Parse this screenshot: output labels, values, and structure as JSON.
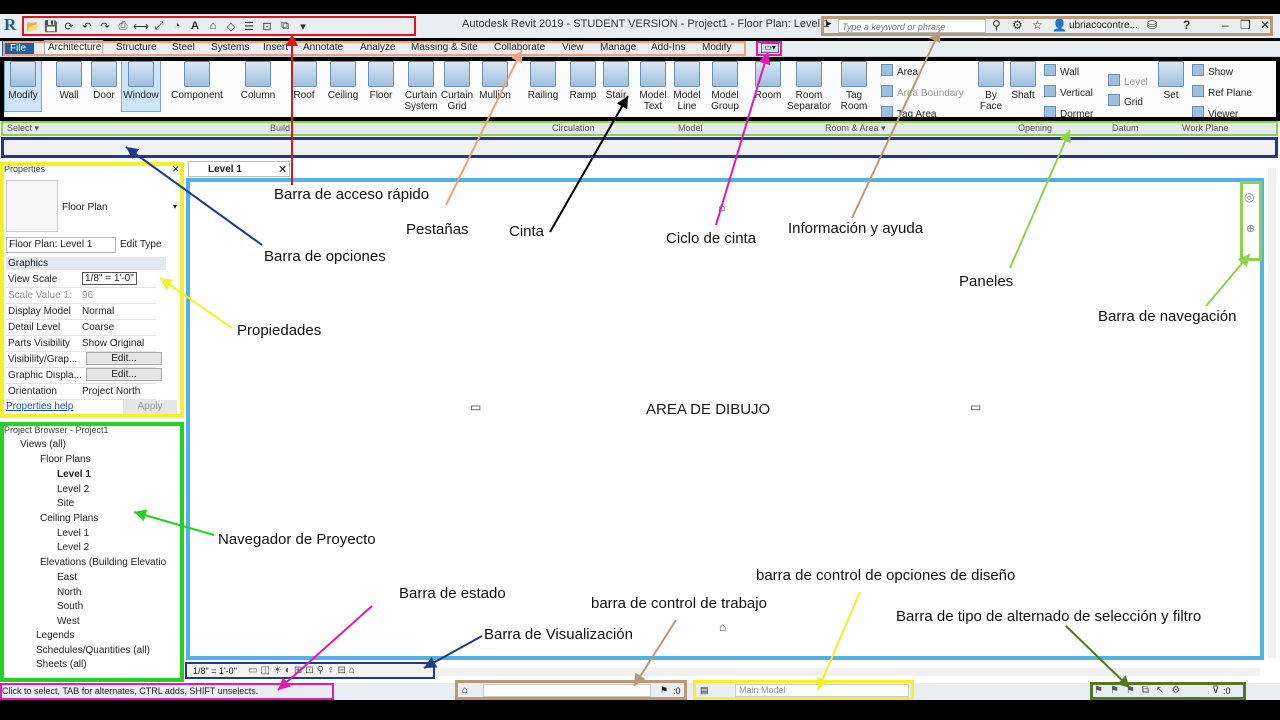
{
  "app": {
    "logo": "R",
    "title": "Autodesk Revit 2019 - STUDENT VERSION - Project1 - Floor Plan: Level 1",
    "search_placeholder": "Type a keyword or phrase",
    "user": "ubriacocontre...",
    "help_icon": "?"
  },
  "tabs": [
    "File",
    "Architecture",
    "Structure",
    "Steel",
    "Systems",
    "Insert",
    "Annotate",
    "Analyze",
    "Massing & Site",
    "Collaborate",
    "View",
    "Manage",
    "Add-Ins",
    "Modify"
  ],
  "ribbon": {
    "buttons": [
      "Modify",
      "Wall",
      "Door",
      "Window",
      "Component",
      "Column",
      "Roof",
      "Ceiling",
      "Floor",
      "Curtain System",
      "Curtain Grid",
      "Mullion",
      "Railing",
      "Ramp",
      "Stair",
      "Model Text",
      "Model Line",
      "Model Group",
      "Room",
      "Room Separator",
      "Tag Room",
      "By Face",
      "Shaft",
      "Set"
    ],
    "small": [
      "Area",
      "Area Boundary",
      "Tag Area",
      "Wall",
      "Vertical",
      "Dormer",
      "Level",
      "Grid",
      "Show",
      "Ref Plane",
      "Viewer"
    ],
    "panels": [
      "Select ▾",
      "Build",
      "Circulation",
      "Model",
      "Room & Area ▾",
      "Opening",
      "Datum",
      "Work Plane"
    ]
  },
  "properties": {
    "header": "Properties",
    "type": "Floor Plan",
    "selector": "Floor Plan: Level 1",
    "edit_type": "Edit Type",
    "section": "Graphics",
    "rows": [
      {
        "k": "View Scale",
        "v": "1/8\" = 1'-0\""
      },
      {
        "k": "Scale Value    1:",
        "v": "96"
      },
      {
        "k": "Display Model",
        "v": "Normal"
      },
      {
        "k": "Detail Level",
        "v": "Coarse"
      },
      {
        "k": "Parts Visibility",
        "v": "Show Original"
      },
      {
        "k": "Visibility/Grap...",
        "v": "Edit..."
      },
      {
        "k": "Graphic Displa...",
        "v": "Edit..."
      },
      {
        "k": "Orientation",
        "v": "Project North"
      }
    ],
    "help": "Properties help",
    "apply": "Apply"
  },
  "browser": {
    "header": "Project Browser - Project1",
    "items": [
      "Views (all)",
      "Floor Plans",
      "Level 1",
      "Level 2",
      "Site",
      "Ceiling Plans",
      "Level 1",
      "Level 2",
      "Elevations (Building Elevatio",
      "East",
      "North",
      "South",
      "West",
      "Legends",
      "Schedules/Quantities (all)",
      "Sheets (all)"
    ]
  },
  "view": {
    "tab": "Level 1",
    "scale": "1/8\" = 1'-0\"",
    "drawing_label": "AREA DE DIBUJO"
  },
  "status": {
    "text": "Click to select, TAB for alternates, CTRL adds, SHIFT unselects.",
    "worksets_count": ":0",
    "design_option": "Main Model",
    "filter_count": ":0"
  },
  "callouts": {
    "qat": "Barra de acceso rápido",
    "tabs": "Pestañas",
    "ribbon": "Cinta",
    "cycle": "Ciclo de cinta",
    "info": "Información y ayuda",
    "options": "Barra de opciones",
    "panels": "Paneles",
    "nav": "Barra de navegación",
    "props": "Propiedades",
    "browser": "Navegador de Proyecto",
    "statusbar": "Barra de estado",
    "viewctrl": "Barra de Visualización",
    "workset": "barra de control de trabajo",
    "design": "barra de control de opciones de diseño",
    "selfilter": "Barra de tipo de alternado de selección y filtro"
  },
  "colors": {
    "red": "#e0141b",
    "salmon": "#f0a07a",
    "black": "#000000",
    "magenta": "#e418b4",
    "tan": "#b99a74",
    "navy": "#1f3a8a",
    "lime": "#8ed24a",
    "yellow": "#f5f02a",
    "green": "#22d322",
    "cyan": "#4fb3e3",
    "olive": "#4e7a22"
  }
}
